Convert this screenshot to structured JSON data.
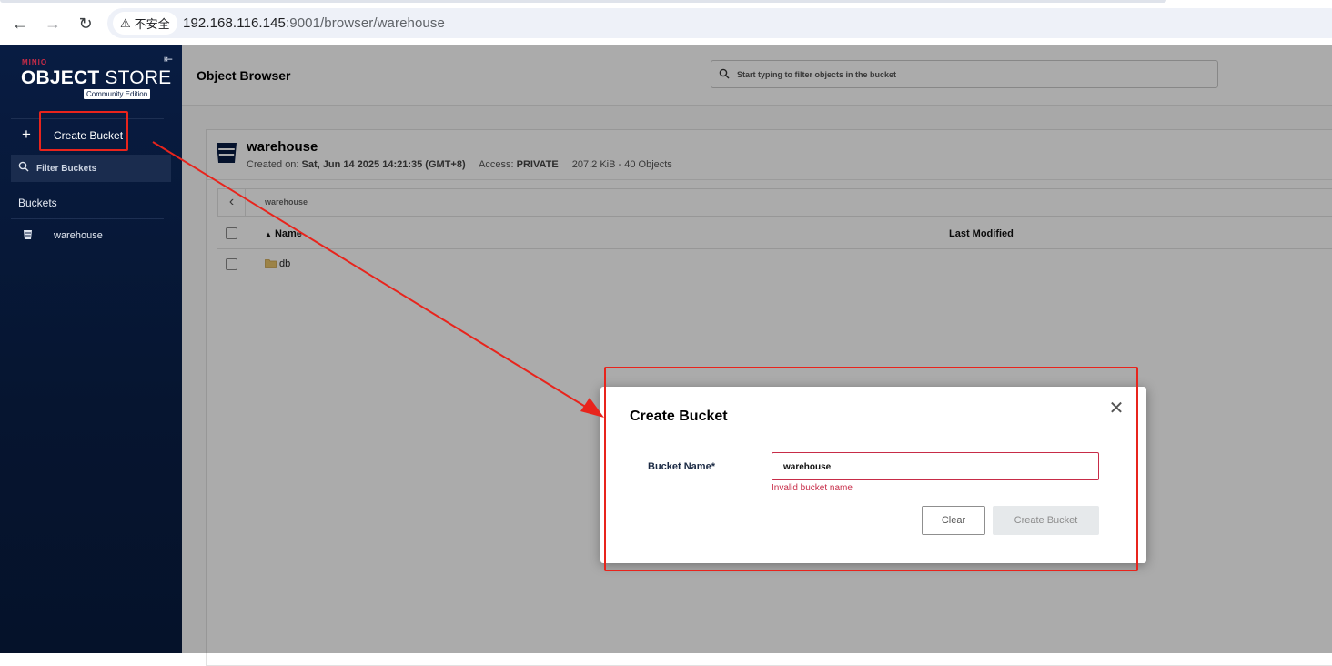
{
  "browser": {
    "security_label": "不安全",
    "url_host": "192.168.116.145",
    "url_path": ":9001/browser/warehouse"
  },
  "sidebar": {
    "logo_brand": "MINIO",
    "logo_object": "OBJECT",
    "logo_store": " STORE",
    "logo_edition": "Community Edition",
    "create_bucket_label": "Create Bucket",
    "filter_placeholder": "Filter Buckets",
    "buckets_heading": "Buckets",
    "bucket_items": [
      {
        "label": "warehouse"
      }
    ]
  },
  "main": {
    "title": "Object Browser",
    "search_placeholder": "Start typing to filter objects in the bucket",
    "bucket": {
      "name": "warehouse",
      "created_label": "Created on:",
      "created_value": "Sat, Jun 14 2025 14:21:35 (GMT+8)",
      "access_label": "Access:",
      "access_value": "PRIVATE",
      "summary": "207.2 KiB - 40 Objects"
    },
    "breadcrumb": "warehouse",
    "table": {
      "columns": [
        "Name",
        "Last Modified"
      ],
      "sort_indicator": "▲",
      "rows": [
        {
          "name": "db",
          "last_modified": ""
        }
      ]
    }
  },
  "modal": {
    "title": "Create Bucket",
    "field_label": "Bucket Name*",
    "field_value": "warehouse",
    "error_text": "Invalid bucket name",
    "clear_label": "Clear",
    "create_label": "Create Bucket"
  },
  "colors": {
    "sidebar_bg": "#081c42",
    "accent_red": "#c72c48",
    "annotation_red": "#e8241c"
  }
}
